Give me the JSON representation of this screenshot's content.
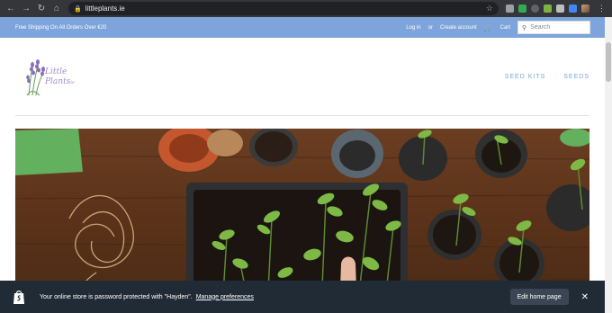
{
  "browser": {
    "url": "littleplants.ie"
  },
  "announcement": {
    "text": "Free Shipping On All Orders Over €20",
    "login": "Log in",
    "or": "or",
    "create_account": "Create account",
    "cart": "Cart",
    "search_placeholder": "Search"
  },
  "header": {
    "logo_line1": "Little",
    "logo_line2": "Plants",
    "logo_suffix": "ie",
    "nav": [
      "SEED KITS",
      "SEEDS"
    ]
  },
  "password_bar": {
    "message": "Your online store is password protected with \"Hayden\".",
    "manage": "Manage preferences",
    "edit_button": "Edit home page"
  },
  "colors": {
    "brand_blue": "#7da4db",
    "logo_purple": "#a38cc8",
    "bar_dark": "#212b36"
  }
}
